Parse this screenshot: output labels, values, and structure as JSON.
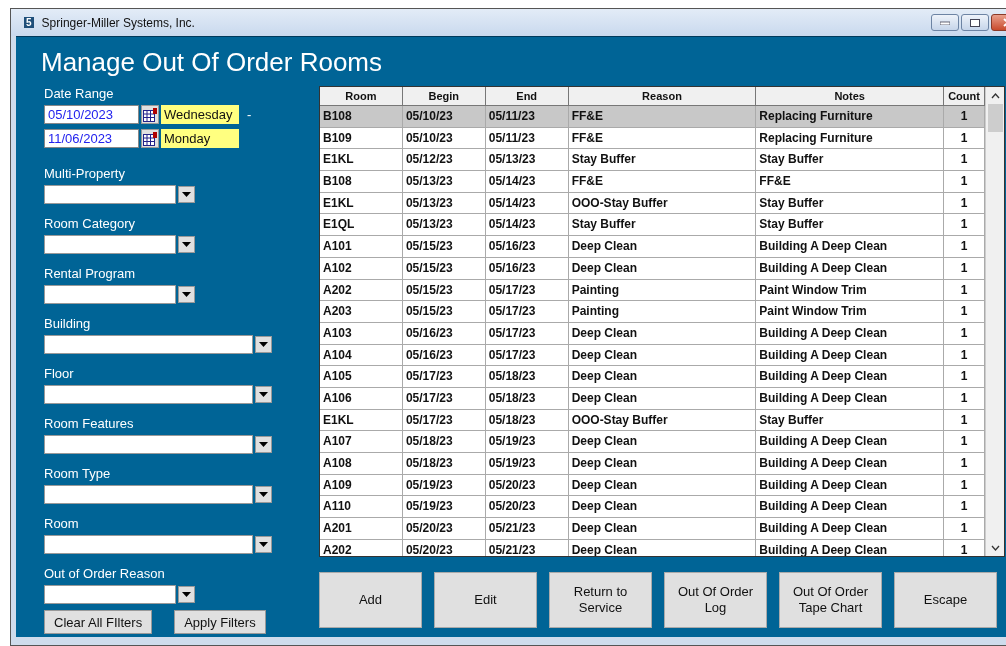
{
  "window": {
    "app_icon": "5",
    "title": "Springer-Miller Systems, Inc."
  },
  "heading": "Manage Out Of Order Rooms",
  "date_range": {
    "label": "Date Range",
    "separator": "-",
    "dates": [
      {
        "value": "05/10/2023",
        "day": "Wednesday"
      },
      {
        "value": "11/06/2023",
        "day": "Monday"
      }
    ]
  },
  "filters": [
    {
      "label": "Multi-Property",
      "kind": "short"
    },
    {
      "label": "Room Category",
      "kind": "short"
    },
    {
      "label": "Rental Program",
      "kind": "short"
    },
    {
      "label": "Building",
      "kind": "long"
    },
    {
      "label": "Floor",
      "kind": "long"
    },
    {
      "label": "Room Features",
      "kind": "long"
    },
    {
      "label": "Room Type",
      "kind": "long"
    },
    {
      "label": "Room",
      "kind": "long"
    },
    {
      "label": "Out of Order Reason",
      "kind": "short"
    }
  ],
  "filter_buttons": [
    "Clear All FIlters",
    "Apply Filters"
  ],
  "table": {
    "columns": [
      "Room",
      "Begin",
      "End",
      "Reason",
      "Notes",
      "Count"
    ],
    "rows": [
      {
        "cells": [
          "B108",
          "05/10/23",
          "05/11/23",
          "FF&E",
          "Replacing Furniture",
          "1"
        ],
        "selected": true
      },
      {
        "cells": [
          "B109",
          "05/10/23",
          "05/11/23",
          "FF&E",
          "Replacing Furniture",
          "1"
        ],
        "selected": false
      },
      {
        "cells": [
          "E1KL",
          "05/12/23",
          "05/13/23",
          "Stay Buffer",
          "Stay Buffer",
          "1"
        ],
        "selected": false
      },
      {
        "cells": [
          "B108",
          "05/13/23",
          "05/14/23",
          "FF&E",
          "FF&E",
          "1"
        ],
        "selected": false
      },
      {
        "cells": [
          "E1KL",
          "05/13/23",
          "05/14/23",
          "OOO-Stay Buffer",
          "Stay Buffer",
          "1"
        ],
        "selected": false
      },
      {
        "cells": [
          "E1QL",
          "05/13/23",
          "05/14/23",
          "Stay Buffer",
          "Stay Buffer",
          "1"
        ],
        "selected": false
      },
      {
        "cells": [
          "A101",
          "05/15/23",
          "05/16/23",
          "Deep Clean",
          "Building A Deep Clean",
          "1"
        ],
        "selected": false
      },
      {
        "cells": [
          "A102",
          "05/15/23",
          "05/16/23",
          "Deep Clean",
          "Building A Deep Clean",
          "1"
        ],
        "selected": false
      },
      {
        "cells": [
          "A202",
          "05/15/23",
          "05/17/23",
          "Painting",
          "Paint Window Trim",
          "1"
        ],
        "selected": false
      },
      {
        "cells": [
          "A203",
          "05/15/23",
          "05/17/23",
          "Painting",
          "Paint Window Trim",
          "1"
        ],
        "selected": false
      },
      {
        "cells": [
          "A103",
          "05/16/23",
          "05/17/23",
          "Deep Clean",
          "Building A Deep Clean",
          "1"
        ],
        "selected": false
      },
      {
        "cells": [
          "A104",
          "05/16/23",
          "05/17/23",
          "Deep Clean",
          "Building A Deep Clean",
          "1"
        ],
        "selected": false
      },
      {
        "cells": [
          "A105",
          "05/17/23",
          "05/18/23",
          "Deep Clean",
          "Building A Deep Clean",
          "1"
        ],
        "selected": false
      },
      {
        "cells": [
          "A106",
          "05/17/23",
          "05/18/23",
          "Deep Clean",
          "Building A Deep Clean",
          "1"
        ],
        "selected": false
      },
      {
        "cells": [
          "E1KL",
          "05/17/23",
          "05/18/23",
          "OOO-Stay Buffer",
          "Stay Buffer",
          "1"
        ],
        "selected": false
      },
      {
        "cells": [
          "A107",
          "05/18/23",
          "05/19/23",
          "Deep Clean",
          "Building A Deep Clean",
          "1"
        ],
        "selected": false
      },
      {
        "cells": [
          "A108",
          "05/18/23",
          "05/19/23",
          "Deep Clean",
          "Building A Deep Clean",
          "1"
        ],
        "selected": false
      },
      {
        "cells": [
          "A109",
          "05/19/23",
          "05/20/23",
          "Deep Clean",
          "Building A Deep Clean",
          "1"
        ],
        "selected": false
      },
      {
        "cells": [
          "A110",
          "05/19/23",
          "05/20/23",
          "Deep Clean",
          "Building A Deep Clean",
          "1"
        ],
        "selected": false
      },
      {
        "cells": [
          "A201",
          "05/20/23",
          "05/21/23",
          "Deep Clean",
          "Building A Deep Clean",
          "1"
        ],
        "selected": false
      },
      {
        "cells": [
          "A202",
          "05/20/23",
          "05/21/23",
          "Deep Clean",
          "Building A Deep Clean",
          "1"
        ],
        "selected": false
      }
    ]
  },
  "action_buttons": [
    "Add",
    "Edit",
    "Return to\nService",
    "Out Of Order\nLog",
    "Out Of Order\nTape Chart",
    "Escape"
  ]
}
